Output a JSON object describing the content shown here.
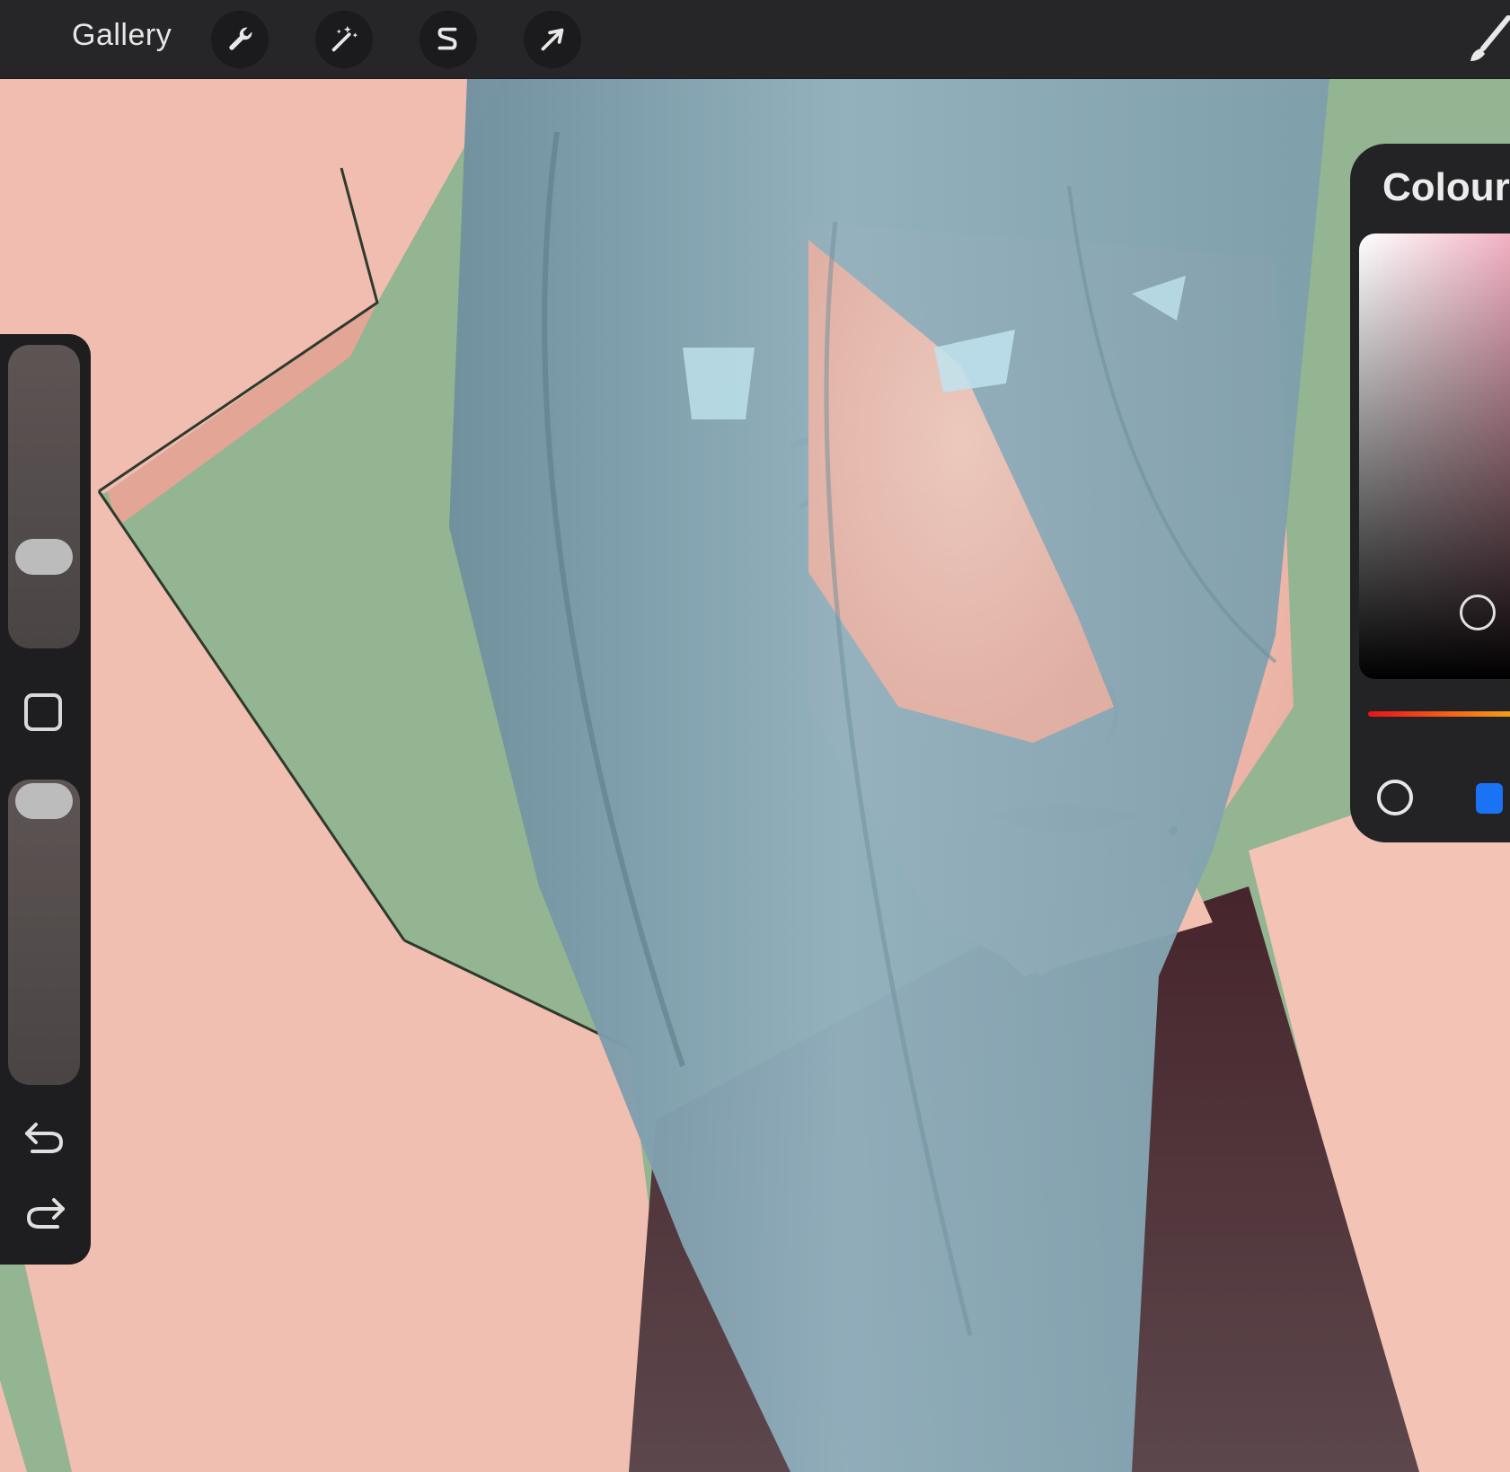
{
  "toolbar": {
    "gallery_label": "Gallery",
    "tools": [
      "wrench-icon",
      "magic-wand-icon",
      "selection-s-icon",
      "transform-arrow-icon"
    ],
    "right_tool": "brush-icon"
  },
  "sidebar": {
    "brush_size_level": 0.63,
    "brush_opacity_level": 1.0,
    "buttons": [
      "modify-square-icon",
      "undo-icon",
      "redo-icon"
    ]
  },
  "colour_panel": {
    "title": "Colour",
    "current_colour": "#3e2a2e",
    "recent_colour": "#1a73f5"
  },
  "colors": {
    "toolbar_bg": "#262628",
    "sidebar_bg": "#1e1e20",
    "canvas_background_green": "#93b591",
    "skin": "#f0bcae",
    "hair": "#8fadb9",
    "top": "#4a2b30"
  }
}
